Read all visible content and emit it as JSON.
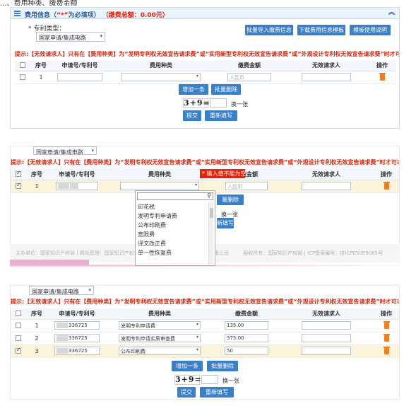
{
  "caption": "...、费用种类、缴费金额",
  "panel1": {
    "header_title_prefix": "费用信息（",
    "header_star": "“*”",
    "header_title_suffix": "为必填项）",
    "header_total": "（缴费总额：0.00元）",
    "patent_type_label": "* 专利类型：",
    "patent_type_value": "国家申请/集成电路",
    "btn_import": "批量导入缴费信息",
    "btn_download": "下载费用信息模板",
    "btn_template_help": "模板使用说明",
    "warning": "提示:【无效请求人】只有在【费用种类】为“发明专利权无效宣告请求费”或“实用新型专利权无效宣告请求费”或“外观设计专利权无效宣告请求费”时才可以填写!",
    "columns": [
      "序号",
      "申请号/专利号",
      "费用种类",
      "缴费金额",
      "无效请求人",
      "操作"
    ],
    "rows": [
      {
        "index": "1",
        "app_no": "",
        "fee_type": "",
        "amount_placeholder": "人民币",
        "requester": ""
      }
    ],
    "btn_add": "增加一条",
    "btn_batch_delete": "批量删除",
    "captcha": "3+9=",
    "refresh": "换一张",
    "btn_submit": "提交",
    "btn_reset": "重新填写"
  },
  "panel2": {
    "patent_type_value": "国家申请/集成电路",
    "warning": "提示:【无效请求人】只有在【费用种类】为“发明专利权无效宣告请求费”或“实用新型专利权无效宣告请求费”或“外观设计专利权无效宣告请求费”时才可以填写!",
    "columns": [
      "序号",
      "申请号/专利号",
      "费用种类",
      "缴费金额",
      "无效请求人",
      "操作"
    ],
    "rows": [
      {
        "index": "1",
        "amount_placeholder": "人民币"
      }
    ],
    "tooltip": "* 输入值不能为空",
    "dropdown_items": [
      "印花税",
      "发明专利申请费",
      "公布印刷费",
      "宽限费",
      "译文改正费",
      "单一性恢复费"
    ],
    "btn_batch_delete_partial": "量删除",
    "refresh": "换一张",
    "btn_reset_partial": "新填写",
    "footer_left": "主办单位：国家知识产权局 | 网站管理：国家知识产权局",
    "footer_mid": "知识产权出版社有限公司",
    "footer_right": "版权所有：国家知识产权局 | ICP备案编号：京ICP05069085号"
  },
  "panel3": {
    "patent_type_value": "国家申请/集成电路",
    "warning": "提示:【无效请求人】只有在【费用种类】为“发明专利权无效宣告请求费”或“实用新型专利权无效宣告请求费”或“外观设计专利权无效宣告请求费”时才可以填写!",
    "columns": [
      "序号",
      "申请号/专利号",
      "费用种类",
      "缴费金额",
      "无效请求人",
      "操作"
    ],
    "rows": [
      {
        "index": "1",
        "app_no": "336725",
        "fee_type": "发明专利申请费",
        "amount": "135.00",
        "checked": false
      },
      {
        "index": "2",
        "app_no": "336725",
        "fee_type": "发明专利申请实质审查费",
        "amount": "375.00",
        "checked": false
      },
      {
        "index": "3",
        "app_no": "336725",
        "fee_type": "公布印刷费",
        "amount": "50",
        "checked": true
      }
    ],
    "btn_add": "增加一条",
    "btn_batch_delete": "批量删除",
    "captcha": "3+9=",
    "refresh": "换一张",
    "btn_submit": "提交",
    "btn_reset": "重新填写"
  }
}
